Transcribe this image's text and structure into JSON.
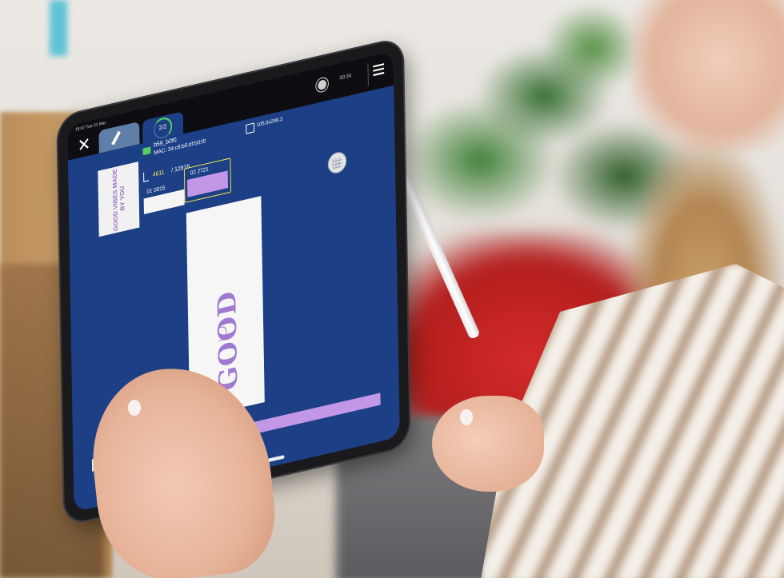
{
  "status_bar": {
    "time": "15:47 Tue 31 Mar"
  },
  "toolbar": {
    "progress_ring": "2/2",
    "network_label": "00:34"
  },
  "device": {
    "name": "b59_b0f0",
    "mac": "MAC: 34:c8:b0:df:b0:f0",
    "size": "105.6x299.3"
  },
  "preview": {
    "text": "GOOD VIBES MADE BY YOU"
  },
  "counter": {
    "current": "4611",
    "total": "/ 12818"
  },
  "segments": [
    {
      "label": "01  0015",
      "selected": false
    },
    {
      "label": "02  2721",
      "selected": true
    }
  ],
  "canvas": {
    "print_text": "GOOD"
  },
  "progress": {
    "fraction": 0.16
  },
  "colors": {
    "screen_bg": "#1d3f85",
    "accent_purple": "#c197e6",
    "ring_green": "#56d15a",
    "highlight_yellow": "#e6e04a"
  },
  "icons": [
    "close-icon",
    "pencil-icon",
    "progress-ring-icon",
    "network-icon",
    "menu-icon",
    "device-icon",
    "size-icon",
    "counter-icon",
    "compass-icon",
    "marker-icon"
  ]
}
